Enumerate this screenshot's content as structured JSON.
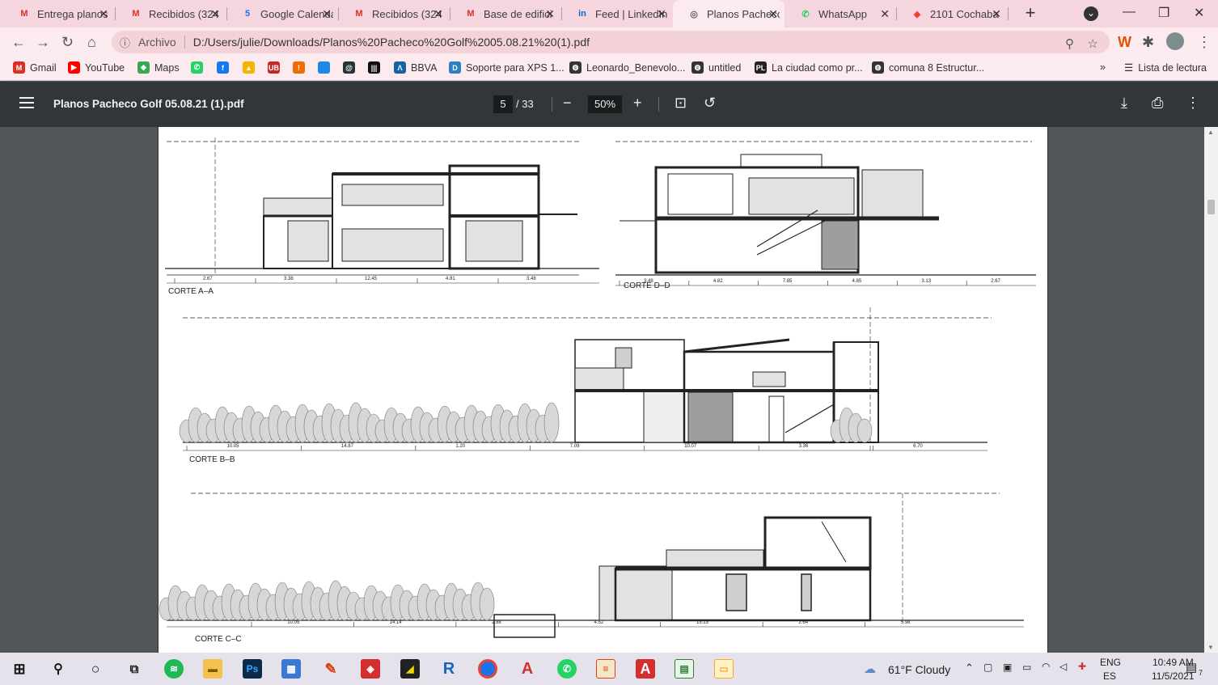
{
  "tabs": [
    {
      "title": "Entrega planos",
      "fav": "M",
      "favColor": "#d93025"
    },
    {
      "title": "Recibidos (324",
      "fav": "M",
      "favColor": "#d93025"
    },
    {
      "title": "Google Calenda",
      "fav": "5",
      "favColor": "#1a73e8"
    },
    {
      "title": "Recibidos (324",
      "fav": "M",
      "favColor": "#d93025"
    },
    {
      "title": "Base de edifici",
      "fav": "M",
      "favColor": "#d93025"
    },
    {
      "title": "Feed | LinkedIn",
      "fav": "in",
      "favColor": "#0a66c2"
    },
    {
      "title": "Planos Pacheco",
      "fav": "◎",
      "favColor": "#5f6368"
    },
    {
      "title": "WhatsApp",
      "fav": "✆",
      "favColor": "#25d366"
    },
    {
      "title": "2101 Cochaba",
      "fav": "◆",
      "favColor": "#ea4335"
    }
  ],
  "address": {
    "scheme": "Archivo",
    "url": "D:/Users/julie/Downloads/Planos%20Pacheco%20Golf%2005.08.21%20(1).pdf"
  },
  "bookmarks": [
    {
      "label": "Gmail",
      "icon": "gmail-icon",
      "color": "#d93025",
      "glyph": "M"
    },
    {
      "label": "YouTube",
      "icon": "youtube-icon",
      "color": "#ff0000",
      "glyph": "▶"
    },
    {
      "label": "Maps",
      "icon": "maps-icon",
      "color": "#34a853",
      "glyph": "◆"
    },
    {
      "label": "",
      "icon": "whatsapp-icon",
      "color": "#25d366",
      "glyph": "✆"
    },
    {
      "label": "",
      "icon": "facebook-icon",
      "color": "#1877f2",
      "glyph": "f"
    },
    {
      "label": "",
      "icon": "drive-icon",
      "color": "#f4b400",
      "glyph": "▲"
    },
    {
      "label": "",
      "icon": "ub-icon",
      "color": "#c62828",
      "glyph": "UB"
    },
    {
      "label": "",
      "icon": "orange-icon",
      "color": "#ef6c00",
      "glyph": "!"
    },
    {
      "label": "",
      "icon": "blue-square-icon",
      "color": "#1e88e5",
      "glyph": ""
    },
    {
      "label": "",
      "icon": "circle-logo-icon",
      "color": "#263238",
      "glyph": "@"
    },
    {
      "label": "",
      "icon": "black-logo-icon",
      "color": "#111111",
      "glyph": "|||"
    },
    {
      "label": "BBVA",
      "icon": "bbva-icon",
      "color": "#1464a5",
      "glyph": "Λ"
    },
    {
      "label": "Soporte para XPS 1...",
      "icon": "dell-icon",
      "color": "#2f7fc1",
      "glyph": "D"
    },
    {
      "label": "Leonardo_Benevolo...",
      "icon": "globe-icon",
      "color": "#333333",
      "glyph": "◍"
    },
    {
      "label": "untitled",
      "icon": "globe-icon",
      "color": "#333333",
      "glyph": "◍"
    },
    {
      "label": "La ciudad como pr...",
      "icon": "book-icon",
      "color": "#222222",
      "glyph": "PL"
    },
    {
      "label": "comuna 8 Estructur...",
      "icon": "globe-icon",
      "color": "#333333",
      "glyph": "◍"
    }
  ],
  "reading_list": "Lista de lectura",
  "pdf": {
    "title": "Planos Pacheco Golf 05.08.21 (1).pdf",
    "page": "5",
    "total": "/ 33",
    "zoom": "50%"
  },
  "drawing": {
    "sections": [
      {
        "label": "CORTE A–A",
        "dims": [
          "2.67",
          "3.38",
          "12.45",
          "4.81",
          "3.48"
        ]
      },
      {
        "label": "CORTE D–D",
        "dims": [
          "3.48",
          "4.82",
          "7.85",
          "4.85",
          "3.13",
          "2.67"
        ]
      },
      {
        "label": "CORTE B–B",
        "dims": [
          "10.05",
          "14.87",
          "1.20",
          "7.09",
          "10.07",
          "3.36",
          "6.70"
        ]
      },
      {
        "label": "CORTE C–C",
        "dims": [
          "10.05",
          "14.14",
          "2.88",
          "4.52",
          "13.13",
          "2.64",
          "5.98"
        ]
      }
    ]
  },
  "taskbar": {
    "weather": "61°F  Cloudy",
    "lang1": "ENG",
    "lang2": "ES",
    "time": "10:49 AM",
    "date": "11/5/2021",
    "notif": "7"
  }
}
